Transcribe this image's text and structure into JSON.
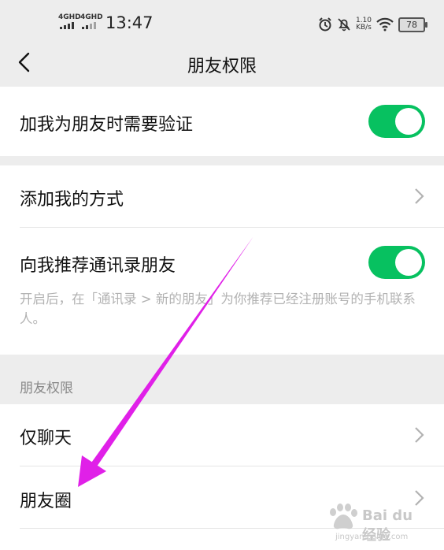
{
  "status_bar": {
    "signal_1": "4GHD",
    "signal_2": "4GHD",
    "time": "13:47",
    "net_speed_value": "1.10",
    "net_speed_unit": "KB/s",
    "battery": "78",
    "icons": [
      "alarm-icon",
      "mute-icon",
      "wifi-icon",
      "battery-icon"
    ]
  },
  "nav": {
    "title": "朋友权限",
    "back_icon": "back-chevron-icon"
  },
  "settings": {
    "verify": {
      "label": "加我为朋友时需要验证",
      "enabled": true
    },
    "add_methods": {
      "label": "添加我的方式"
    },
    "recommend_contacts": {
      "label": "向我推荐通讯录朋友",
      "enabled": true,
      "description": "开启后，在「通讯录 > 新的朋友」为你推荐已经注册账号的手机联系人。"
    }
  },
  "permissions_section": {
    "header": "朋友权限",
    "items": [
      {
        "label": "仅聊天"
      },
      {
        "label": "朋友圈"
      }
    ]
  },
  "annotation": {
    "color": "#e020e8",
    "icon": "arrow-annotation"
  },
  "watermark": {
    "brand": "Bai du 经验",
    "url": "jingyan.baidu.com"
  },
  "colors": {
    "toggle_on": "#07c160",
    "background": "#ededed"
  }
}
